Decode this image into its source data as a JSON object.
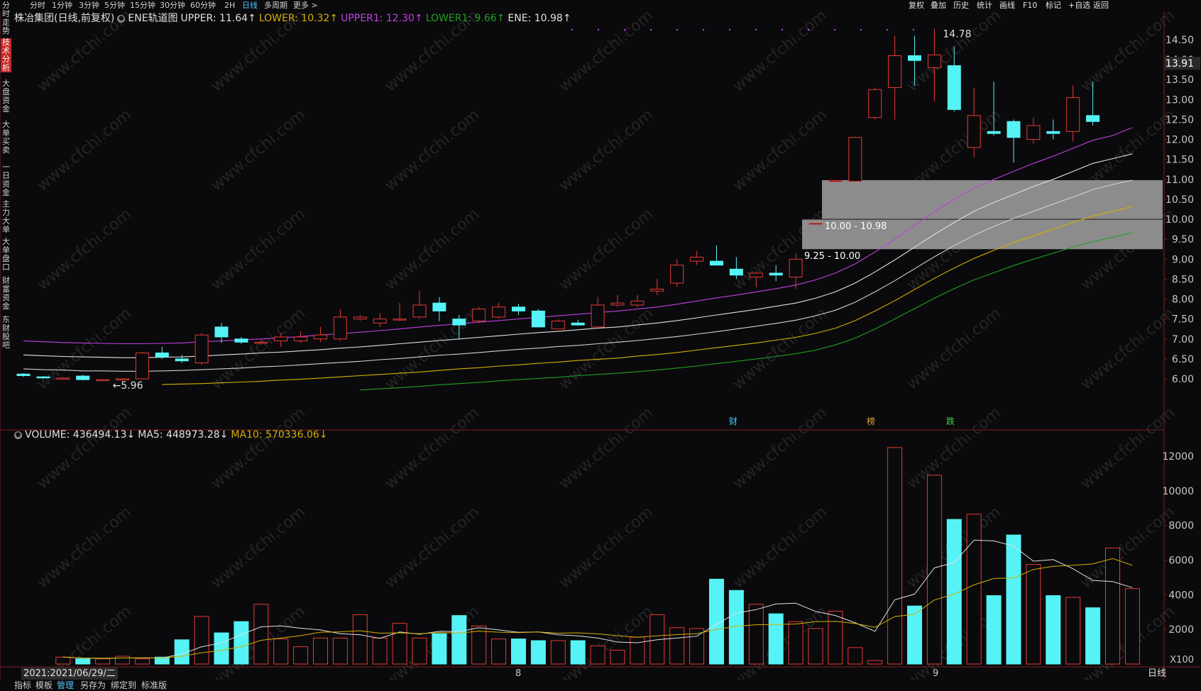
{
  "topbar": {
    "periods": [
      "分时",
      "1分钟",
      "3分钟",
      "5分钟",
      "15分钟",
      "30分钟",
      "60分钟",
      "2H",
      "日线",
      "多周期",
      "更多 >"
    ],
    "active_period": "日线",
    "right_tools": [
      "复权",
      "叠加",
      "历史",
      "统计",
      "画线",
      "F10",
      "标记",
      "+自选",
      "返回"
    ]
  },
  "sidebar": {
    "items": [
      "分时走势",
      "技术分析",
      "大盘资金",
      "大单买卖",
      "一日资金",
      "主力大单",
      "大单盘口",
      "财富资金",
      "东财股吧"
    ],
    "active_index": 1
  },
  "infobar": {
    "title": "株冶集团(日线,前复权)",
    "indicator": "ENE轨道图",
    "upper": "UPPER: 11.64↑",
    "lower": "LOWER: 10.32↑",
    "upper1": "UPPER1: 12.30↑",
    "lower1": "LOWER1: 9.66↑",
    "ene": "ENE: 10.98↑"
  },
  "volbar": {
    "volume": "VOLUME: 436494.13↓",
    "ma5": "MA5: 448973.28↓",
    "ma10": "MA10: 570336.06↓"
  },
  "price_axis": {
    "ticks": [
      "14.50",
      "14.00",
      "13.50",
      "13.00",
      "12.50",
      "12.00",
      "11.50",
      "11.00",
      "10.50",
      "10.00",
      "9.50",
      "9.00",
      "8.50",
      "8.00",
      "7.50",
      "7.00",
      "6.50",
      "6.00"
    ],
    "current": "13.91"
  },
  "volume_axis": {
    "ticks": [
      "12000",
      "10000",
      "8000",
      "6000",
      "4000",
      "2000"
    ],
    "unit": "X100"
  },
  "annotations": {
    "high": "14.78",
    "low": "5.96",
    "zone1": "10.00 - 10.98",
    "zone2": "9.25 - 10.00",
    "markers": [
      "财",
      "榜",
      "跌"
    ]
  },
  "datebar": {
    "date": "2021:2021/06/29/二",
    "months": [
      "8",
      "9"
    ],
    "right": "日线"
  },
  "bottombar": {
    "items": [
      "指标",
      "模板",
      "管理",
      "另存为",
      "绑定到",
      "标准版"
    ],
    "active": "管理"
  },
  "watermark": "www.cfchi.com",
  "colors": {
    "up": "#e53935",
    "down": "#55f3f5",
    "upper1": "#c040e0",
    "upper": "#e0e0e0",
    "ene": "#d0d0d0",
    "lower": "#d4b000",
    "lower1": "#20a020",
    "vol_ma5": "#e0e0e0",
    "vol_ma10": "#d4b000"
  },
  "chart_data": [
    {
      "type": "candlestick",
      "title": "株冶集团(日线,前复权)",
      "ylim": [
        5.75,
        14.75
      ],
      "x": [
        1,
        2,
        3,
        4,
        5,
        6,
        7,
        8,
        9,
        10,
        11,
        12,
        13,
        14,
        15,
        16,
        17,
        18,
        19,
        20,
        21,
        22,
        23,
        24,
        25,
        26,
        27,
        28,
        29,
        30,
        31,
        32,
        33,
        34,
        35,
        36,
        37,
        38,
        39,
        40,
        41,
        42,
        43,
        44,
        45,
        46,
        47,
        48,
        49,
        50,
        51,
        52,
        53,
        54,
        55,
        56,
        57
      ],
      "candles": [
        {
          "o": 6.12,
          "c": 6.08,
          "h": 6.14,
          "l": 6.05
        },
        {
          "o": 6.05,
          "c": 6.03,
          "h": 6.07,
          "l": 6.0
        },
        {
          "o": 6.02,
          "c": 6.02,
          "h": 6.04,
          "l": 6.0
        },
        {
          "o": 6.07,
          "c": 5.98,
          "h": 6.1,
          "l": 5.96
        },
        {
          "o": 5.96,
          "c": 5.98,
          "h": 6.0,
          "l": 5.96
        },
        {
          "o": 5.98,
          "c": 6.0,
          "h": 6.02,
          "l": 5.96
        },
        {
          "o": 6.0,
          "c": 6.65,
          "h": 6.68,
          "l": 5.98
        },
        {
          "o": 6.65,
          "c": 6.55,
          "h": 6.8,
          "l": 6.5
        },
        {
          "o": 6.5,
          "c": 6.45,
          "h": 6.6,
          "l": 6.4
        },
        {
          "o": 6.4,
          "c": 7.1,
          "h": 7.15,
          "l": 6.35
        },
        {
          "o": 7.3,
          "c": 7.05,
          "h": 7.4,
          "l": 6.9
        },
        {
          "o": 7.0,
          "c": 6.92,
          "h": 7.05,
          "l": 6.88
        },
        {
          "o": 6.9,
          "c": 6.92,
          "h": 6.96,
          "l": 6.85
        },
        {
          "o": 6.95,
          "c": 7.05,
          "h": 7.15,
          "l": 6.8
        },
        {
          "o": 6.95,
          "c": 7.05,
          "h": 7.2,
          "l": 6.9
        },
        {
          "o": 7.0,
          "c": 7.1,
          "h": 7.3,
          "l": 6.92
        },
        {
          "o": 7.0,
          "c": 7.55,
          "h": 7.75,
          "l": 6.95
        },
        {
          "o": 7.5,
          "c": 7.55,
          "h": 7.6,
          "l": 7.45
        },
        {
          "o": 7.4,
          "c": 7.5,
          "h": 7.65,
          "l": 7.3
        },
        {
          "o": 7.5,
          "c": 7.5,
          "h": 7.9,
          "l": 7.45
        },
        {
          "o": 7.55,
          "c": 7.85,
          "h": 8.2,
          "l": 7.5
        },
        {
          "o": 7.9,
          "c": 7.7,
          "h": 8.05,
          "l": 7.45
        },
        {
          "o": 7.5,
          "c": 7.35,
          "h": 7.6,
          "l": 7.0
        },
        {
          "o": 7.45,
          "c": 7.75,
          "h": 7.8,
          "l": 7.4
        },
        {
          "o": 7.55,
          "c": 7.8,
          "h": 7.9,
          "l": 7.5
        },
        {
          "o": 7.8,
          "c": 7.7,
          "h": 7.88,
          "l": 7.6
        },
        {
          "o": 7.7,
          "c": 7.3,
          "h": 7.75,
          "l": 7.3
        },
        {
          "o": 7.25,
          "c": 7.45,
          "h": 7.5,
          "l": 7.25
        },
        {
          "o": 7.4,
          "c": 7.35,
          "h": 7.48,
          "l": 7.33
        },
        {
          "o": 7.3,
          "c": 7.85,
          "h": 8.05,
          "l": 7.25
        },
        {
          "o": 7.85,
          "c": 7.9,
          "h": 8.1,
          "l": 7.8
        },
        {
          "o": 7.85,
          "c": 7.95,
          "h": 8.1,
          "l": 7.8
        },
        {
          "o": 8.2,
          "c": 8.25,
          "h": 8.5,
          "l": 8.1
        },
        {
          "o": 8.4,
          "c": 8.85,
          "h": 9.0,
          "l": 8.3
        },
        {
          "o": 8.95,
          "c": 9.05,
          "h": 9.2,
          "l": 8.85
        },
        {
          "o": 8.95,
          "c": 8.85,
          "h": 9.35,
          "l": 8.85
        },
        {
          "o": 8.75,
          "c": 8.6,
          "h": 9.05,
          "l": 8.5
        },
        {
          "o": 8.55,
          "c": 8.65,
          "h": 8.7,
          "l": 8.3
        },
        {
          "o": 8.65,
          "c": 8.6,
          "h": 8.85,
          "l": 8.45
        },
        {
          "o": 8.55,
          "c": 9.0,
          "h": 9.15,
          "l": 8.25
        },
        {
          "o": 9.9,
          "c": 9.9,
          "h": 9.9,
          "l": 9.9
        },
        {
          "o": 10.97,
          "c": 10.97,
          "h": 10.97,
          "l": 10.97
        },
        {
          "o": 10.95,
          "c": 12.05,
          "h": 12.07,
          "l": 10.95
        },
        {
          "o": 12.55,
          "c": 13.25,
          "h": 13.3,
          "l": 12.5
        },
        {
          "o": 13.3,
          "c": 14.1,
          "h": 14.6,
          "l": 12.5
        },
        {
          "o": 14.1,
          "c": 13.98,
          "h": 14.6,
          "l": 13.35
        },
        {
          "o": 13.8,
          "c": 14.12,
          "h": 14.78,
          "l": 12.95
        },
        {
          "o": 13.85,
          "c": 12.75,
          "h": 14.32,
          "l": 12.7
        },
        {
          "o": 11.8,
          "c": 12.6,
          "h": 13.3,
          "l": 11.55
        },
        {
          "o": 12.2,
          "c": 12.15,
          "h": 13.45,
          "l": 12.1
        },
        {
          "o": 12.45,
          "c": 12.05,
          "h": 12.5,
          "l": 11.42
        },
        {
          "o": 12.0,
          "c": 12.35,
          "h": 12.55,
          "l": 11.9
        },
        {
          "o": 12.2,
          "c": 12.15,
          "h": 12.5,
          "l": 12.0
        },
        {
          "o": 12.2,
          "c": 13.05,
          "h": 13.35,
          "l": 11.95
        },
        {
          "o": 12.6,
          "c": 12.45,
          "h": 13.45,
          "l": 12.35
        }
      ],
      "series": [
        {
          "name": "UPPER1",
          "values": [
            6.95,
            6.93,
            6.91,
            6.9,
            6.89,
            6.88,
            6.88,
            6.89,
            6.9,
            6.93,
            6.95,
            6.98,
            7.0,
            7.03,
            7.06,
            7.1,
            7.13,
            7.17,
            7.21,
            7.25,
            7.3,
            7.34,
            7.38,
            7.42,
            7.46,
            7.5,
            7.54,
            7.58,
            7.62,
            7.66,
            7.7,
            7.75,
            7.8,
            7.87,
            7.95,
            8.03,
            8.1,
            8.18,
            8.26,
            8.35,
            8.48,
            8.65,
            8.88,
            9.18,
            9.5,
            9.85,
            10.18,
            10.5,
            10.78,
            11.0,
            11.2,
            11.4,
            11.58,
            11.78,
            11.98,
            12.1,
            12.3
          ]
        },
        {
          "name": "UPPER",
          "values": [
            6.6,
            6.58,
            6.56,
            6.55,
            6.54,
            6.53,
            6.53,
            6.54,
            6.55,
            6.57,
            6.6,
            6.62,
            6.65,
            6.67,
            6.7,
            6.73,
            6.77,
            6.8,
            6.84,
            6.88,
            6.92,
            6.96,
            7.0,
            7.04,
            7.08,
            7.12,
            7.16,
            7.19,
            7.23,
            7.27,
            7.3,
            7.35,
            7.4,
            7.46,
            7.53,
            7.6,
            7.67,
            7.74,
            7.82,
            7.9,
            8.02,
            8.18,
            8.4,
            8.68,
            8.98,
            9.3,
            9.62,
            9.92,
            10.2,
            10.42,
            10.62,
            10.82,
            11.0,
            11.2,
            11.4,
            11.52,
            11.64
          ]
        },
        {
          "name": "ENE",
          "values": [
            6.25,
            6.23,
            6.22,
            6.2,
            6.2,
            6.19,
            6.19,
            6.2,
            6.21,
            6.23,
            6.25,
            6.27,
            6.3,
            6.32,
            6.35,
            6.38,
            6.41,
            6.44,
            6.48,
            6.51,
            6.55,
            6.59,
            6.62,
            6.66,
            6.7,
            6.74,
            6.77,
            6.81,
            6.84,
            6.88,
            6.92,
            6.96,
            7.01,
            7.06,
            7.12,
            7.18,
            7.25,
            7.32,
            7.39,
            7.47,
            7.58,
            7.72,
            7.92,
            8.18,
            8.46,
            8.76,
            9.06,
            9.34,
            9.6,
            9.82,
            10.02,
            10.2,
            10.38,
            10.56,
            10.74,
            10.87,
            10.98
          ]
        },
        {
          "name": "LOWER",
          "values": [
            5.9,
            5.89,
            5.88,
            5.87,
            5.86,
            5.86,
            5.86,
            5.86,
            5.87,
            5.88,
            5.9,
            5.92,
            5.94,
            5.97,
            5.99,
            6.02,
            6.05,
            6.08,
            6.11,
            6.14,
            6.17,
            6.21,
            6.25,
            6.28,
            6.32,
            6.35,
            6.39,
            6.42,
            6.46,
            6.49,
            6.52,
            6.57,
            6.61,
            6.66,
            6.72,
            6.78,
            6.84,
            6.9,
            6.97,
            7.04,
            7.14,
            7.27,
            7.46,
            7.7,
            7.96,
            8.24,
            8.52,
            8.78,
            9.02,
            9.22,
            9.42,
            9.58,
            9.75,
            9.92,
            10.08,
            10.2,
            10.32
          ]
        },
        {
          "name": "LOWER1",
          "values": [
            5.55,
            5.54,
            5.53,
            5.52,
            5.51,
            5.51,
            5.51,
            5.51,
            5.52,
            5.53,
            5.55,
            5.57,
            5.59,
            5.61,
            5.64,
            5.66,
            5.69,
            5.72,
            5.75,
            5.78,
            5.81,
            5.85,
            5.88,
            5.91,
            5.95,
            5.98,
            6.01,
            6.04,
            6.08,
            6.11,
            6.14,
            6.18,
            6.22,
            6.27,
            6.32,
            6.38,
            6.44,
            6.5,
            6.56,
            6.63,
            6.72,
            6.85,
            7.02,
            7.25,
            7.5,
            7.76,
            8.02,
            8.26,
            8.48,
            8.66,
            8.84,
            9.0,
            9.15,
            9.3,
            9.44,
            9.55,
            9.66
          ]
        }
      ],
      "price_zones": [
        {
          "label": "10.00 - 10.98",
          "low": 10.0,
          "high": 10.98
        },
        {
          "label": "9.25 - 10.00",
          "low": 9.25,
          "high": 10.0
        }
      ]
    },
    {
      "type": "bar",
      "title": "VOLUME",
      "ylabel": "X100",
      "ylim": [
        0,
        12800
      ],
      "values": [
        400,
        300,
        300,
        450,
        300,
        400,
        1400,
        2750,
        1800,
        2450,
        3450,
        1450,
        1000,
        1500,
        1500,
        2850,
        1500,
        2350,
        1500,
        1750,
        2800,
        2200,
        1450,
        1450,
        1350,
        1350,
        1350,
        1050,
        800,
        1550,
        2850,
        2100,
        2050,
        4900,
        4250,
        3450,
        2900,
        2450,
        2050,
        3050,
        950,
        200,
        12500,
        3350,
        10900,
        8350,
        8650,
        3950,
        7450,
        5750,
        3950,
        3850,
        3250,
        6700,
        4350
      ],
      "series": [
        {
          "name": "MA5",
          "values": [
            400,
            350,
            330,
            350,
            360,
            350,
            580,
            1000,
            1220,
            1700,
            2150,
            2200,
            2070,
            1970,
            1750,
            1690,
            1480,
            1850,
            1720,
            1890,
            1870,
            2100,
            1970,
            1830,
            1850,
            1690,
            1630,
            1500,
            1270,
            1230,
            1400,
            1500,
            1610,
            2300,
            2940,
            3140,
            3470,
            3510,
            3040,
            2800,
            2380,
            1890,
            3710,
            4040,
            5550,
            5860,
            7150,
            7110,
            6810,
            5940,
            6030,
            5500,
            4830,
            4760,
            4410
          ]
        },
        {
          "name": "MA10",
          "values": [
            400,
            350,
            330,
            350,
            360,
            350,
            450,
            650,
            790,
            1000,
            1370,
            1500,
            1640,
            1840,
            1860,
            1920,
            1780,
            1800,
            1750,
            1820,
            1780,
            1900,
            1840,
            1810,
            1850,
            1780,
            1800,
            1740,
            1640,
            1550,
            1630,
            1700,
            1750,
            2000,
            2180,
            2270,
            2290,
            2310,
            2450,
            2470,
            2340,
            2120,
            2740,
            2870,
            3700,
            4040,
            4570,
            4940,
            4970,
            5460,
            5640,
            5700,
            5780,
            6090,
            5700
          ]
        }
      ]
    }
  ]
}
